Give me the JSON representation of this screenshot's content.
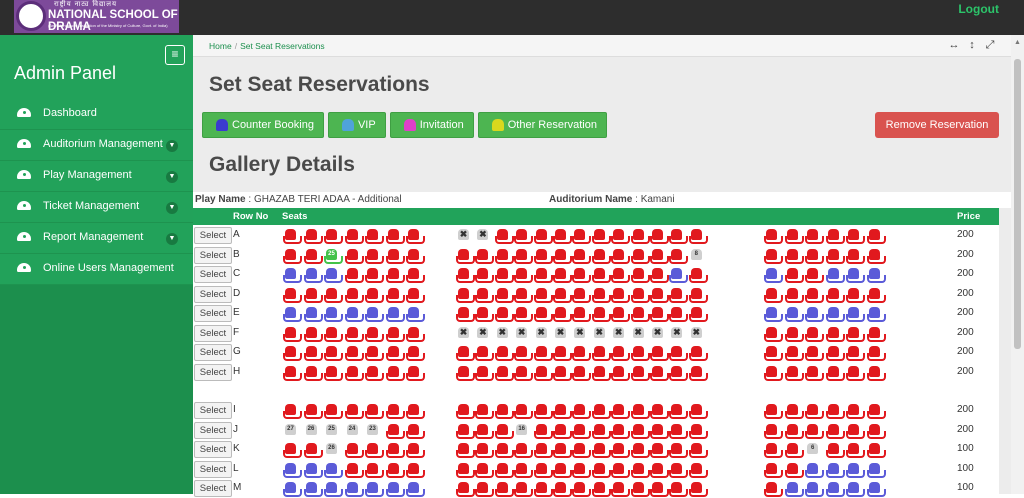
{
  "header": {
    "logo_hindi": "राष्ट्रीय नाट्य विद्यालय",
    "logo_title": "NATIONAL SCHOOL OF DRAMA",
    "logo_subtitle": "(An Autonomous Institution of the Ministry of Culture, Govt. of India)",
    "logout_label": "Logout"
  },
  "sidebar": {
    "title": "Admin Panel",
    "toggle_icon": "collapse-sidebar-icon",
    "items": [
      {
        "label": "Dashboard",
        "icon": "dashboard-icon",
        "has_submenu": false
      },
      {
        "label": "Auditorium Management",
        "icon": "dashboard-icon",
        "has_submenu": true
      },
      {
        "label": "Play Management",
        "icon": "dashboard-icon",
        "has_submenu": true
      },
      {
        "label": "Ticket Management",
        "icon": "dashboard-icon",
        "has_submenu": true
      },
      {
        "label": "Report Management",
        "icon": "dashboard-icon",
        "has_submenu": true
      },
      {
        "label": "Online Users Management",
        "icon": "dashboard-icon",
        "has_submenu": false
      }
    ]
  },
  "breadcrumb": {
    "home": "Home",
    "sep": "/",
    "current": "Set Seat Reservations"
  },
  "window_icons": [
    "↔",
    "↕",
    "⤢"
  ],
  "page_title": "Set Seat Reservations",
  "legend": [
    {
      "label": "Counter Booking",
      "color": "#3b3bd0"
    },
    {
      "label": "VIP",
      "color": "#4fa3d9"
    },
    {
      "label": "Invitation",
      "color": "#e040c8"
    },
    {
      "label": "Other Reservation",
      "color": "#d8d81e"
    }
  ],
  "remove_button": "Remove Reservation",
  "section_title": "Gallery Details",
  "play_label": "Play Name",
  "play_name": "GHAZAB TERI ADAA - Additional",
  "auditorium_label": "Auditorium Name",
  "auditorium_name": "Kamani",
  "columns": {
    "row_no": "Row No",
    "seats": "Seats",
    "price": "Price"
  },
  "select_label": "Select",
  "rows": [
    {
      "row": "A",
      "price": "200",
      "left": "RRRRRRR",
      "center": "XXRRRRRRRRRRR",
      "right": "RRRRRR",
      "grey_nums": {}
    },
    {
      "row": "B",
      "price": "200",
      "left": "RRGRRRR",
      "center": "RRRRRRRRRRRRg",
      "right": "RRRRRR",
      "grey_nums": {
        "center_12": "8",
        "left_2": "25"
      }
    },
    {
      "row": "C",
      "price": "200",
      "left": "BBBRRRR",
      "center": "RRRRRRRRRRRBR",
      "right": "BRRBBB",
      "grey_nums": {}
    },
    {
      "row": "D",
      "price": "200",
      "left": "RRRRRRR",
      "center": "RRRRRRRRRRRRR",
      "right": "RRRRRR",
      "grey_nums": {}
    },
    {
      "row": "E",
      "price": "200",
      "left": "BBBBBBB",
      "center": "RRRRRRRRRRRRR",
      "right": "BBBBBB",
      "grey_nums": {}
    },
    {
      "row": "F",
      "price": "200",
      "left": "RRRRRRR",
      "center": "XXXXXXXXXXXXX",
      "right": "RRRRRR",
      "grey_nums": {}
    },
    {
      "row": "G",
      "price": "200",
      "left": "RRRRRRR",
      "center": "RRRRRRRRRRRRR",
      "right": "RRRRRR",
      "grey_nums": {}
    },
    {
      "row": "H",
      "price": "200",
      "left": "RRRRRRR",
      "center": "RRRRRRRRRRRRR",
      "right": "RRRRRR",
      "grey_nums": {}
    },
    {
      "row": "I",
      "price": "200",
      "left": "RRRRRRR",
      "center": "RRRRRRRRRRRRR",
      "right": "RRRRRR",
      "grey_nums": {}
    },
    {
      "row": "J",
      "price": "200",
      "left": "gggggRR",
      "center": "RRRgRRRRRRRRR",
      "right": "RRRRRR",
      "grey_nums": {
        "left_0": "27",
        "left_1": "26",
        "left_2": "25",
        "left_3": "24",
        "left_4": "23",
        "center_3": "16"
      }
    },
    {
      "row": "K",
      "price": "100",
      "left": "RRgRRRR",
      "center": "RRRRRRRRRRRRR",
      "right": "RRgRRR",
      "grey_nums": {
        "left_2": "26",
        "right_2": "6"
      }
    },
    {
      "row": "L",
      "price": "100",
      "left": "BBBRRRR",
      "center": "RRRRRRRRRRRRR",
      "right": "RRBBBB",
      "grey_nums": {}
    },
    {
      "row": "M",
      "price": "100",
      "left": "BBBBBBB",
      "center": "RRRRRRRRRRRRR",
      "right": "RBBBBB",
      "grey_nums": {}
    }
  ]
}
